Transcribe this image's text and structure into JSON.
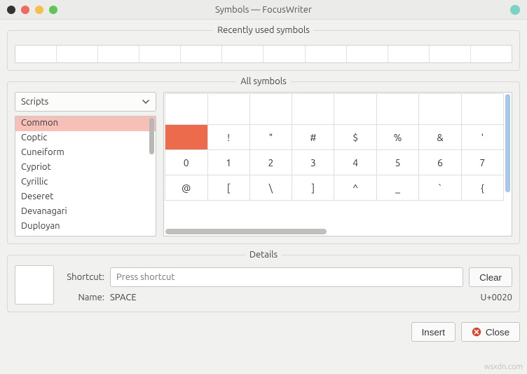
{
  "window": {
    "title": "Symbols — FocusWriter"
  },
  "panels": {
    "recent": "Recently used symbols",
    "all": "All symbols",
    "details": "Details"
  },
  "filter": {
    "combo_label": "Scripts",
    "items": [
      "Common",
      "Coptic",
      "Cuneiform",
      "Cypriot",
      "Cyrillic",
      "Deseret",
      "Devanagari",
      "Duployan"
    ],
    "selected_index": 0
  },
  "grid": {
    "rows": [
      [
        "",
        "",
        "",
        "",
        "",
        "",
        "",
        ""
      ],
      [
        "",
        "!",
        "\"",
        "#",
        "$",
        "%",
        "&",
        "'"
      ],
      [
        "0",
        "1",
        "2",
        "3",
        "4",
        "5",
        "6",
        "7"
      ],
      [
        "@",
        "[",
        "\\",
        "]",
        "^",
        "_",
        "`",
        "{"
      ]
    ],
    "selected": {
      "row": 1,
      "col": 0
    }
  },
  "details": {
    "shortcut_label": "Shortcut:",
    "shortcut_placeholder": "Press shortcut",
    "clear": "Clear",
    "name_label": "Name:",
    "name_value": "SPACE",
    "codepoint": "U+0020"
  },
  "actions": {
    "insert": "Insert",
    "close": "Close"
  },
  "watermark": "wsxdn.com",
  "recent_slots": 12
}
